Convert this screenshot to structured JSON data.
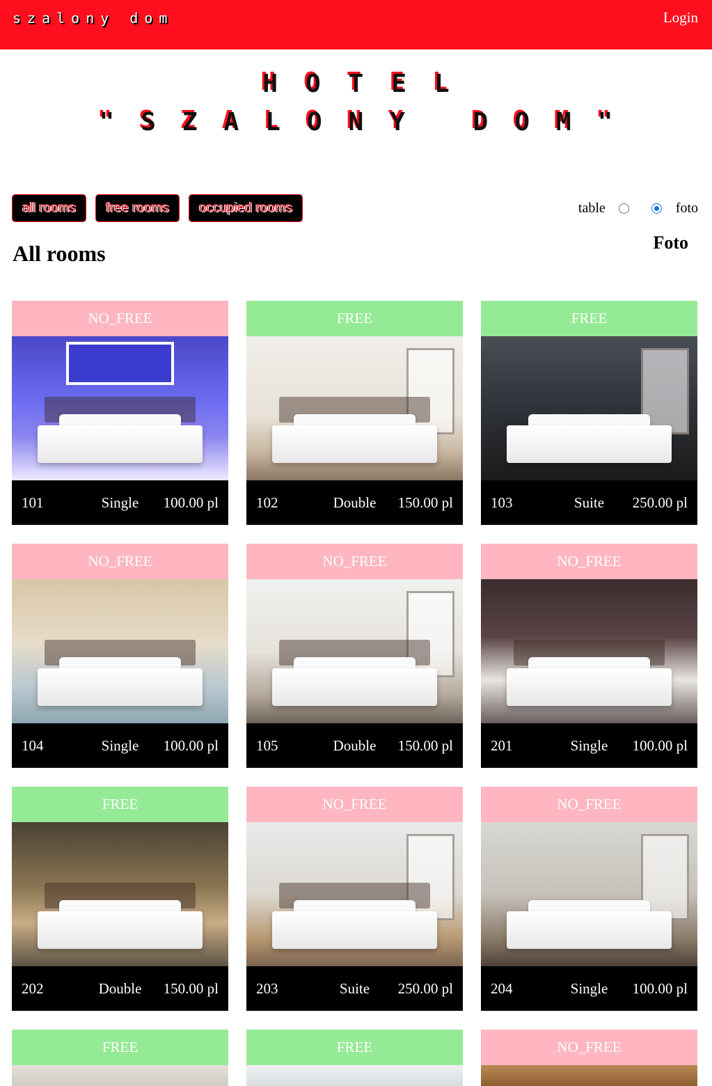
{
  "header": {
    "brand": "szalony dom",
    "login_label": "Login"
  },
  "hero": {
    "line1": "HOTEL",
    "line2": "\"SZALONY DOM\""
  },
  "filters": {
    "all": "all rooms",
    "free": "free rooms",
    "occupied": "occupied rooms"
  },
  "view": {
    "table_label": "table",
    "foto_label": "foto",
    "selected": "foto",
    "mode_title": "Foto"
  },
  "section_title": "All rooms",
  "colors": {
    "brand_red": "#ff0f1e",
    "free": "#95eb95",
    "no_free": "#ffb6c1",
    "info_bar": "#000000"
  },
  "rooms": [
    {
      "status": "NO_FREE",
      "number": "101",
      "type": "Single",
      "price": "100.00 pl"
    },
    {
      "status": "FREE",
      "number": "102",
      "type": "Double",
      "price": "150.00 pl"
    },
    {
      "status": "FREE",
      "number": "103",
      "type": "Suite",
      "price": "250.00 pl"
    },
    {
      "status": "NO_FREE",
      "number": "104",
      "type": "Single",
      "price": "100.00 pl"
    },
    {
      "status": "NO_FREE",
      "number": "105",
      "type": "Double",
      "price": "150.00 pl"
    },
    {
      "status": "NO_FREE",
      "number": "201",
      "type": "Single",
      "price": "100.00 pl"
    },
    {
      "status": "FREE",
      "number": "202",
      "type": "Double",
      "price": "150.00 pl"
    },
    {
      "status": "NO_FREE",
      "number": "203",
      "type": "Suite",
      "price": "250.00 pl"
    },
    {
      "status": "NO_FREE",
      "number": "204",
      "type": "Single",
      "price": "100.00 pl"
    },
    {
      "status": "FREE"
    },
    {
      "status": "FREE"
    },
    {
      "status": "NO_FREE"
    }
  ]
}
